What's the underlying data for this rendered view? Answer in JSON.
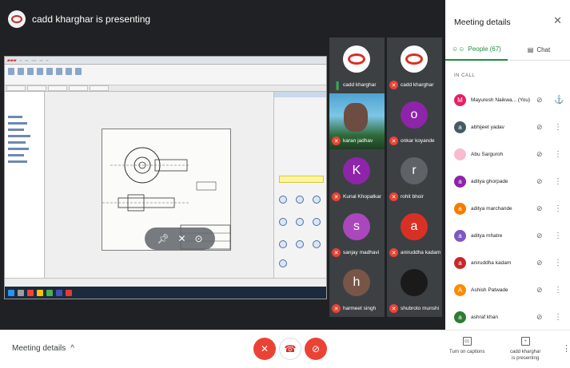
{
  "presenter": {
    "text": "cadd kharghar is presenting"
  },
  "tiles": [
    {
      "name": "cadd kharghar",
      "initial": "",
      "type": "logo",
      "mic": "on"
    },
    {
      "name": "cadd kharghar",
      "initial": "",
      "type": "logo",
      "mic": "off"
    },
    {
      "name": "karan jadhav",
      "initial": "",
      "type": "photo",
      "mic": "off"
    },
    {
      "name": "onkar koyande",
      "initial": "o",
      "type": "letter",
      "color": "#8e24aa",
      "mic": "off"
    },
    {
      "name": "Kunal Khopatkar",
      "initial": "K",
      "type": "letter",
      "color": "#8e24aa",
      "mic": "off"
    },
    {
      "name": "rohit bhoir",
      "initial": "r",
      "type": "letter",
      "color": "#5f6368",
      "mic": "off"
    },
    {
      "name": "sanjay madhavi",
      "initial": "s",
      "type": "letter",
      "color": "#ab47bc",
      "mic": "off"
    },
    {
      "name": "aniruddha kadam",
      "initial": "a",
      "type": "letter",
      "color": "#d93025",
      "mic": "off"
    },
    {
      "name": "harmeet singh",
      "initial": "h",
      "type": "letter",
      "color": "#795548",
      "mic": "off"
    },
    {
      "name": "shubroto munshi",
      "initial": "",
      "type": "dark",
      "mic": "off"
    }
  ],
  "panel": {
    "title": "Meeting details",
    "tab_people": "People (67)",
    "tab_chat": "Chat",
    "section": "IN CALL",
    "people": [
      {
        "name": "Mayuresh Naikwa... (You)",
        "initial": "M",
        "color": "#e91e63",
        "action": "pin"
      },
      {
        "name": "abhijeet yadav",
        "initial": "a",
        "color": "#455a64",
        "action": "more"
      },
      {
        "name": "Abu Sarguroh",
        "initial": "",
        "color": "#f8bbd0",
        "action": "more"
      },
      {
        "name": "aditya ghorpade",
        "initial": "a",
        "color": "#8e24aa",
        "action": "more"
      },
      {
        "name": "aditya marchande",
        "initial": "a",
        "color": "#f57c00",
        "action": "more"
      },
      {
        "name": "aditya mhatre",
        "initial": "a",
        "color": "#7e57c2",
        "action": "more"
      },
      {
        "name": "aniruddha kadam",
        "initial": "a",
        "color": "#c62828",
        "action": "more"
      },
      {
        "name": "Ashish Patwade",
        "initial": "A",
        "color": "#fb8c00",
        "action": "more"
      },
      {
        "name": "ashraf khan",
        "initial": "a",
        "color": "#2e7d32",
        "action": "more"
      }
    ]
  },
  "bottom": {
    "details": "Meeting details",
    "details_chevron": "^",
    "captions": "Turn on captions",
    "presenting_line1": "cadd kharghar",
    "presenting_line2": "is presenting"
  }
}
